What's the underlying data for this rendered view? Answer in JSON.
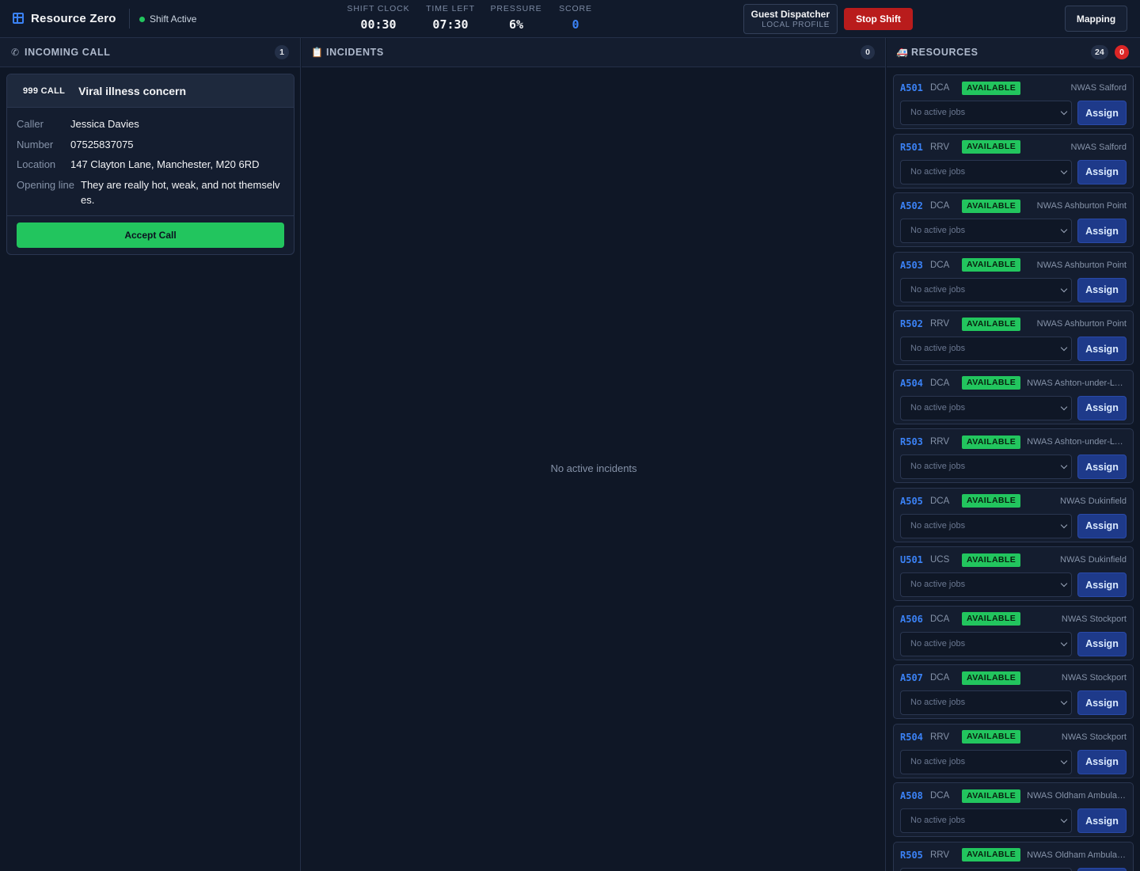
{
  "app": {
    "name": "Resource Zero",
    "shift_status": "Shift Active"
  },
  "stats": [
    {
      "label": "SHIFT CLOCK",
      "value": "00:30"
    },
    {
      "label": "TIME LEFT",
      "value": "07:30"
    },
    {
      "label": "PRESSURE",
      "value": "6%"
    },
    {
      "label": "SCORE",
      "value": "0"
    }
  ],
  "profile": {
    "name": "Guest Dispatcher",
    "sub": "LOCAL PROFILE"
  },
  "buttons": {
    "stop_shift": "Stop Shift",
    "mapping": "Mapping",
    "accept_call": "Accept Call",
    "assign": "Assign"
  },
  "incoming": {
    "title": "INCOMING CALL",
    "count": "1",
    "call": {
      "tag": "999 CALL",
      "title": "Viral illness concern",
      "caller_label": "Caller",
      "caller": "Jessica Davies",
      "number_label": "Number",
      "number": "07525837075",
      "location_label": "Location",
      "location": "147 Clayton Lane, Manchester, M20 6RD",
      "opening_label": "Opening line",
      "opening": "They are really hot, weak, and not themselves."
    }
  },
  "incidents": {
    "title": "INCIDENTS",
    "count": "0",
    "empty": "No active incidents"
  },
  "resources": {
    "title": "RESOURCES",
    "count": "24",
    "alert_count": "0",
    "select_placeholder": "No active jobs",
    "status_color": "#22c55e",
    "items": [
      {
        "callsign": "A501",
        "type": "DCA",
        "status": "AVAILABLE",
        "station": "NWAS Salford"
      },
      {
        "callsign": "R501",
        "type": "RRV",
        "status": "AVAILABLE",
        "station": "NWAS Salford"
      },
      {
        "callsign": "A502",
        "type": "DCA",
        "status": "AVAILABLE",
        "station": "NWAS Ashburton Point"
      },
      {
        "callsign": "A503",
        "type": "DCA",
        "status": "AVAILABLE",
        "station": "NWAS Ashburton Point"
      },
      {
        "callsign": "R502",
        "type": "RRV",
        "status": "AVAILABLE",
        "station": "NWAS Ashburton Point"
      },
      {
        "callsign": "A504",
        "type": "DCA",
        "status": "AVAILABLE",
        "station": "NWAS Ashton-under-Lyne"
      },
      {
        "callsign": "R503",
        "type": "RRV",
        "status": "AVAILABLE",
        "station": "NWAS Ashton-under-Lyne"
      },
      {
        "callsign": "A505",
        "type": "DCA",
        "status": "AVAILABLE",
        "station": "NWAS Dukinfield"
      },
      {
        "callsign": "U501",
        "type": "UCS",
        "status": "AVAILABLE",
        "station": "NWAS Dukinfield"
      },
      {
        "callsign": "A506",
        "type": "DCA",
        "status": "AVAILABLE",
        "station": "NWAS Stockport"
      },
      {
        "callsign": "A507",
        "type": "DCA",
        "status": "AVAILABLE",
        "station": "NWAS Stockport"
      },
      {
        "callsign": "R504",
        "type": "RRV",
        "status": "AVAILABLE",
        "station": "NWAS Stockport"
      },
      {
        "callsign": "A508",
        "type": "DCA",
        "status": "AVAILABLE",
        "station": "NWAS Oldham Ambulance Station"
      },
      {
        "callsign": "R505",
        "type": "RRV",
        "status": "AVAILABLE",
        "station": "NWAS Oldham Ambulance Station"
      }
    ]
  }
}
